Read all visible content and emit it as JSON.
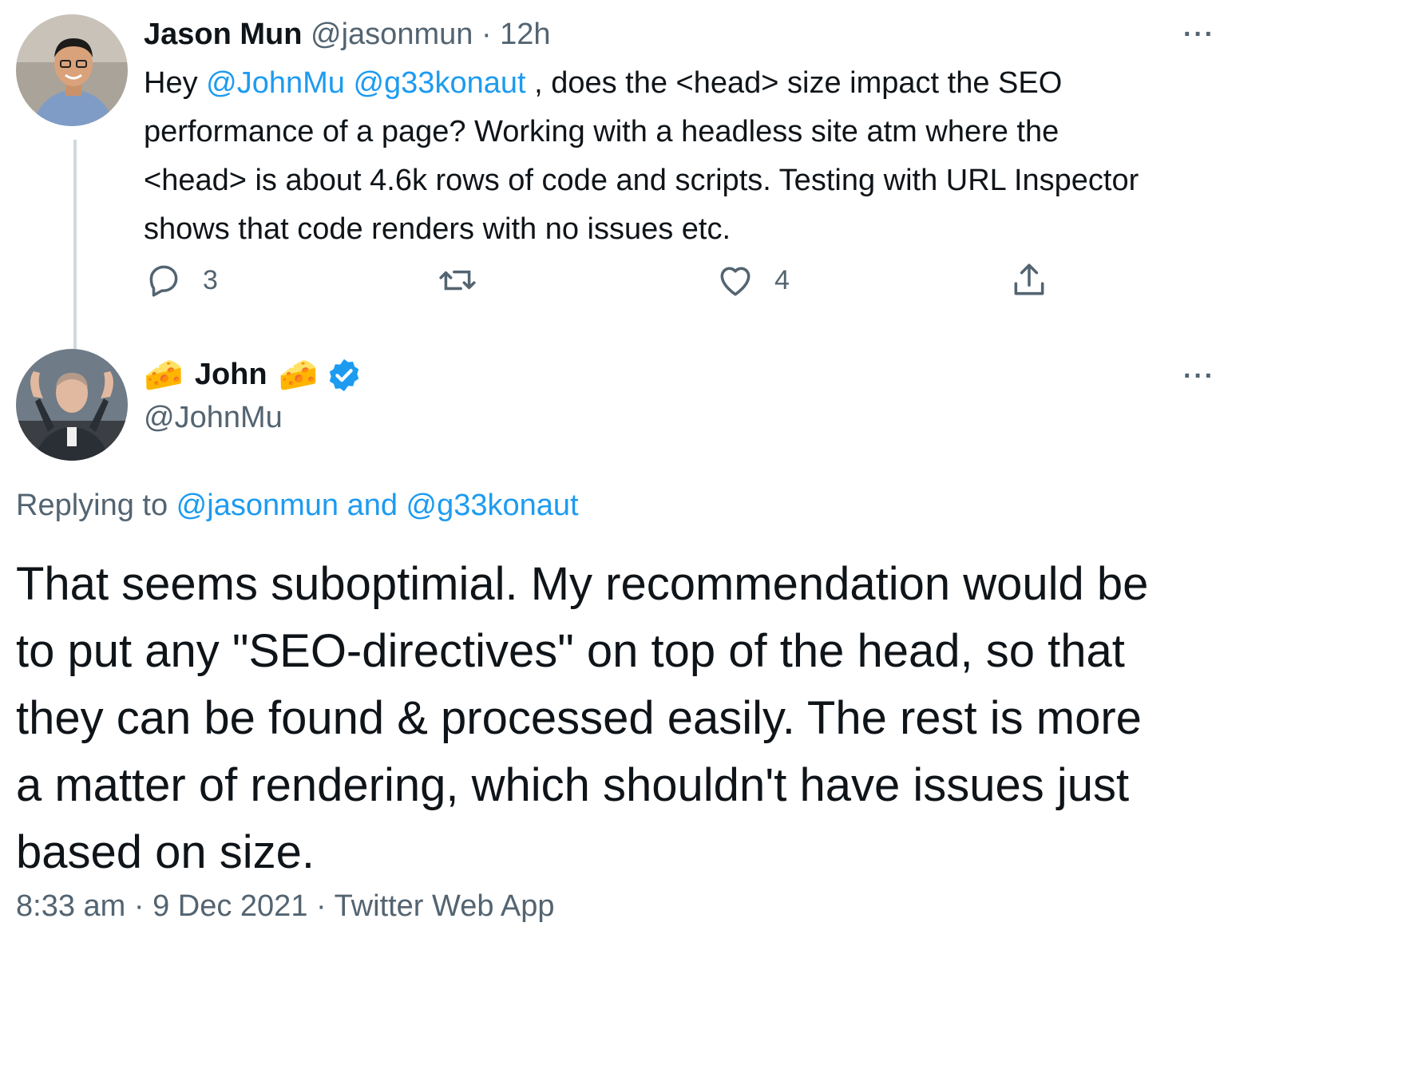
{
  "original_tweet": {
    "name": "Jason Mun",
    "handle": "@jasonmun",
    "separator": "·",
    "time": "12h",
    "text_prefix": "Hey ",
    "mention1": "@JohnMu",
    "mention2": "@g33konaut",
    "text_line1_rest": " , does the <head> size impact the SEO",
    "text_line2": "performance of a page? Working with a headless site atm where the",
    "text_line3": "<head> is about 4.6k rows of code and scripts. Testing with URL Inspector",
    "text_line4": "shows that code renders with no issues etc.",
    "reply_count": "3",
    "like_count": "4",
    "more": "···"
  },
  "reply_tweet": {
    "name_emoji_left": "🧀",
    "name": "John",
    "name_emoji_right": "🧀",
    "handle": "@JohnMu",
    "verified": true,
    "more": "···",
    "replying_to_prefix": "Replying to ",
    "replying_to_user1": "@jasonmun",
    "replying_to_and": " and ",
    "replying_to_user2": "@g33konaut",
    "text_line1": "That seems suboptimial. My recommendation would be",
    "text_line2": "to put any \"SEO-directives\" on top of the head, so that",
    "text_line3": "they can be found & processed easily. The rest is more",
    "text_line4": "a matter of rendering, which shouldn't have issues just",
    "text_line5": "based on size.",
    "time": "8:33 am",
    "sep1": "·",
    "date": "9 Dec 2021",
    "sep2": "·",
    "source": "Twitter Web App"
  },
  "icons": {
    "reply": "speech-bubble-icon",
    "retweet": "retweet-icon",
    "like": "heart-icon",
    "share": "share-icon",
    "verified": "verified-badge-icon",
    "cheese": "cheese-emoji-icon"
  },
  "colors": {
    "link": "#1d9bf0",
    "secondary_text": "#536471",
    "primary_text": "#0f1419",
    "thread_line": "#cfd9de",
    "verified": "#1d9bf0"
  }
}
